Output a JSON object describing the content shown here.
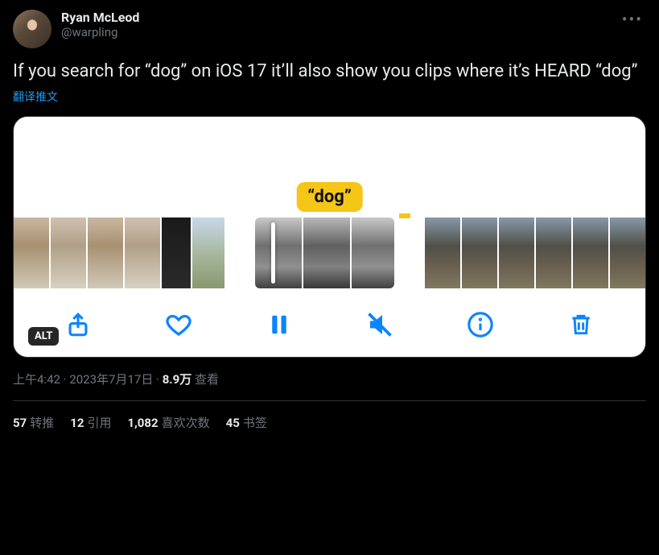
{
  "author": {
    "display_name": "Ryan McLeod",
    "handle": "@warpling"
  },
  "body": "If you search for “dog” on iOS 17 it’ll also show you clips where it’s HEARD “dog”",
  "translate_label": "翻译推文",
  "media": {
    "caption_bubble": "“dog”",
    "alt_badge": "ALT",
    "icons": {
      "share": "share-icon",
      "like": "heart-icon",
      "pause": "pause-icon",
      "mute": "mute-icon",
      "info": "info-icon",
      "trash": "trash-icon"
    }
  },
  "meta": {
    "time": "上午4:42",
    "dot1": " · ",
    "date": "2023年7月17日",
    "dot2": " · ",
    "views_num": "8.9万",
    "views_label": " 查看"
  },
  "stats": {
    "retweets_num": "57",
    "retweets_label": "转推",
    "quotes_num": "12",
    "quotes_label": "引用",
    "likes_num": "1,082",
    "likes_label": "喜欢次数",
    "bookmarks_num": "45",
    "bookmarks_label": "书签"
  }
}
